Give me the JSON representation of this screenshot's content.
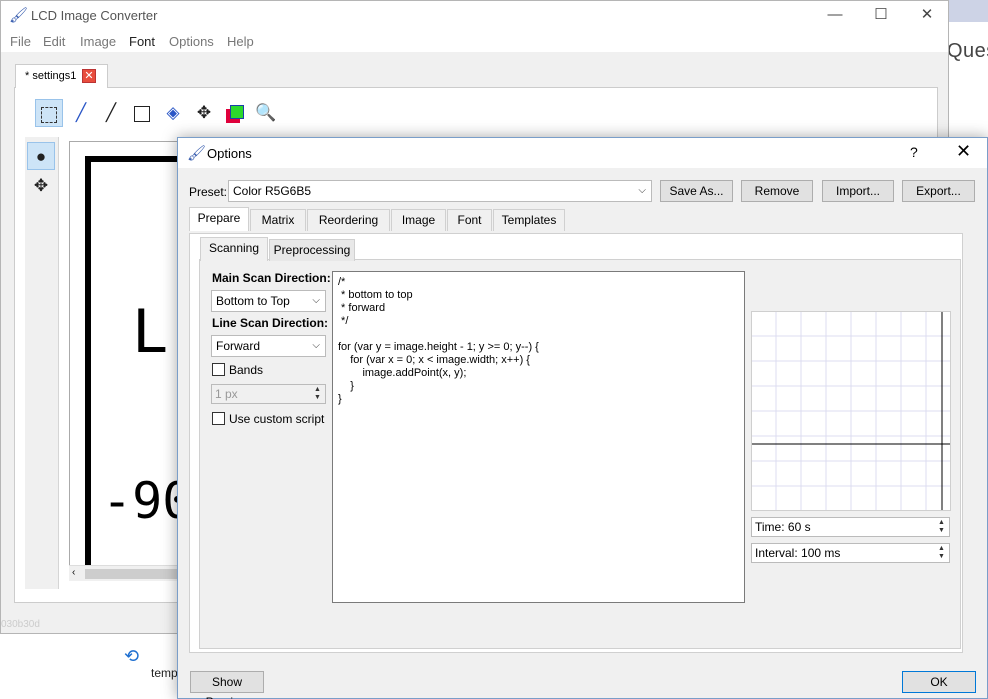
{
  "background": {
    "side_text": "Ques",
    "bottom_text": "temp"
  },
  "main_window": {
    "title": "LCD Image Converter",
    "menu": [
      "File",
      "Edit",
      "Image",
      "Font",
      "Options",
      "Help"
    ],
    "document_tab": "* settings1",
    "canvas_text": {
      "letter": "L",
      "number": "-90"
    },
    "status_text": "030b30d"
  },
  "dialog": {
    "title": "Options",
    "help": "?",
    "close": "✕",
    "preset_label": "Preset:",
    "preset_value": "Color R5G6B5",
    "buttons": {
      "save_as": "Save As...",
      "remove": "Remove",
      "import": "Import...",
      "export": "Export..."
    },
    "tabs": [
      "Prepare",
      "Matrix",
      "Reordering",
      "Image",
      "Font",
      "Templates"
    ],
    "subtabs": [
      "Scanning",
      "Preprocessing"
    ],
    "main_scan_label": "Main Scan Direction:",
    "main_scan_value": "Bottom to Top",
    "line_scan_label": "Line Scan Direction:",
    "line_scan_value": "Forward",
    "bands_label": "Bands",
    "bands_value": "1 px",
    "custom_script_label": "Use custom script",
    "script": "/*\n * bottom to top\n * forward\n */\n\nfor (var y = image.height - 1; y >= 0; y--) {\n    for (var x = 0; x < image.width; x++) {\n        image.addPoint(x, y);\n    }\n}",
    "time_value": "Time: 60 s",
    "interval_value": "Interval: 100 ms",
    "show_preview": "Show Preview",
    "ok": "OK"
  }
}
